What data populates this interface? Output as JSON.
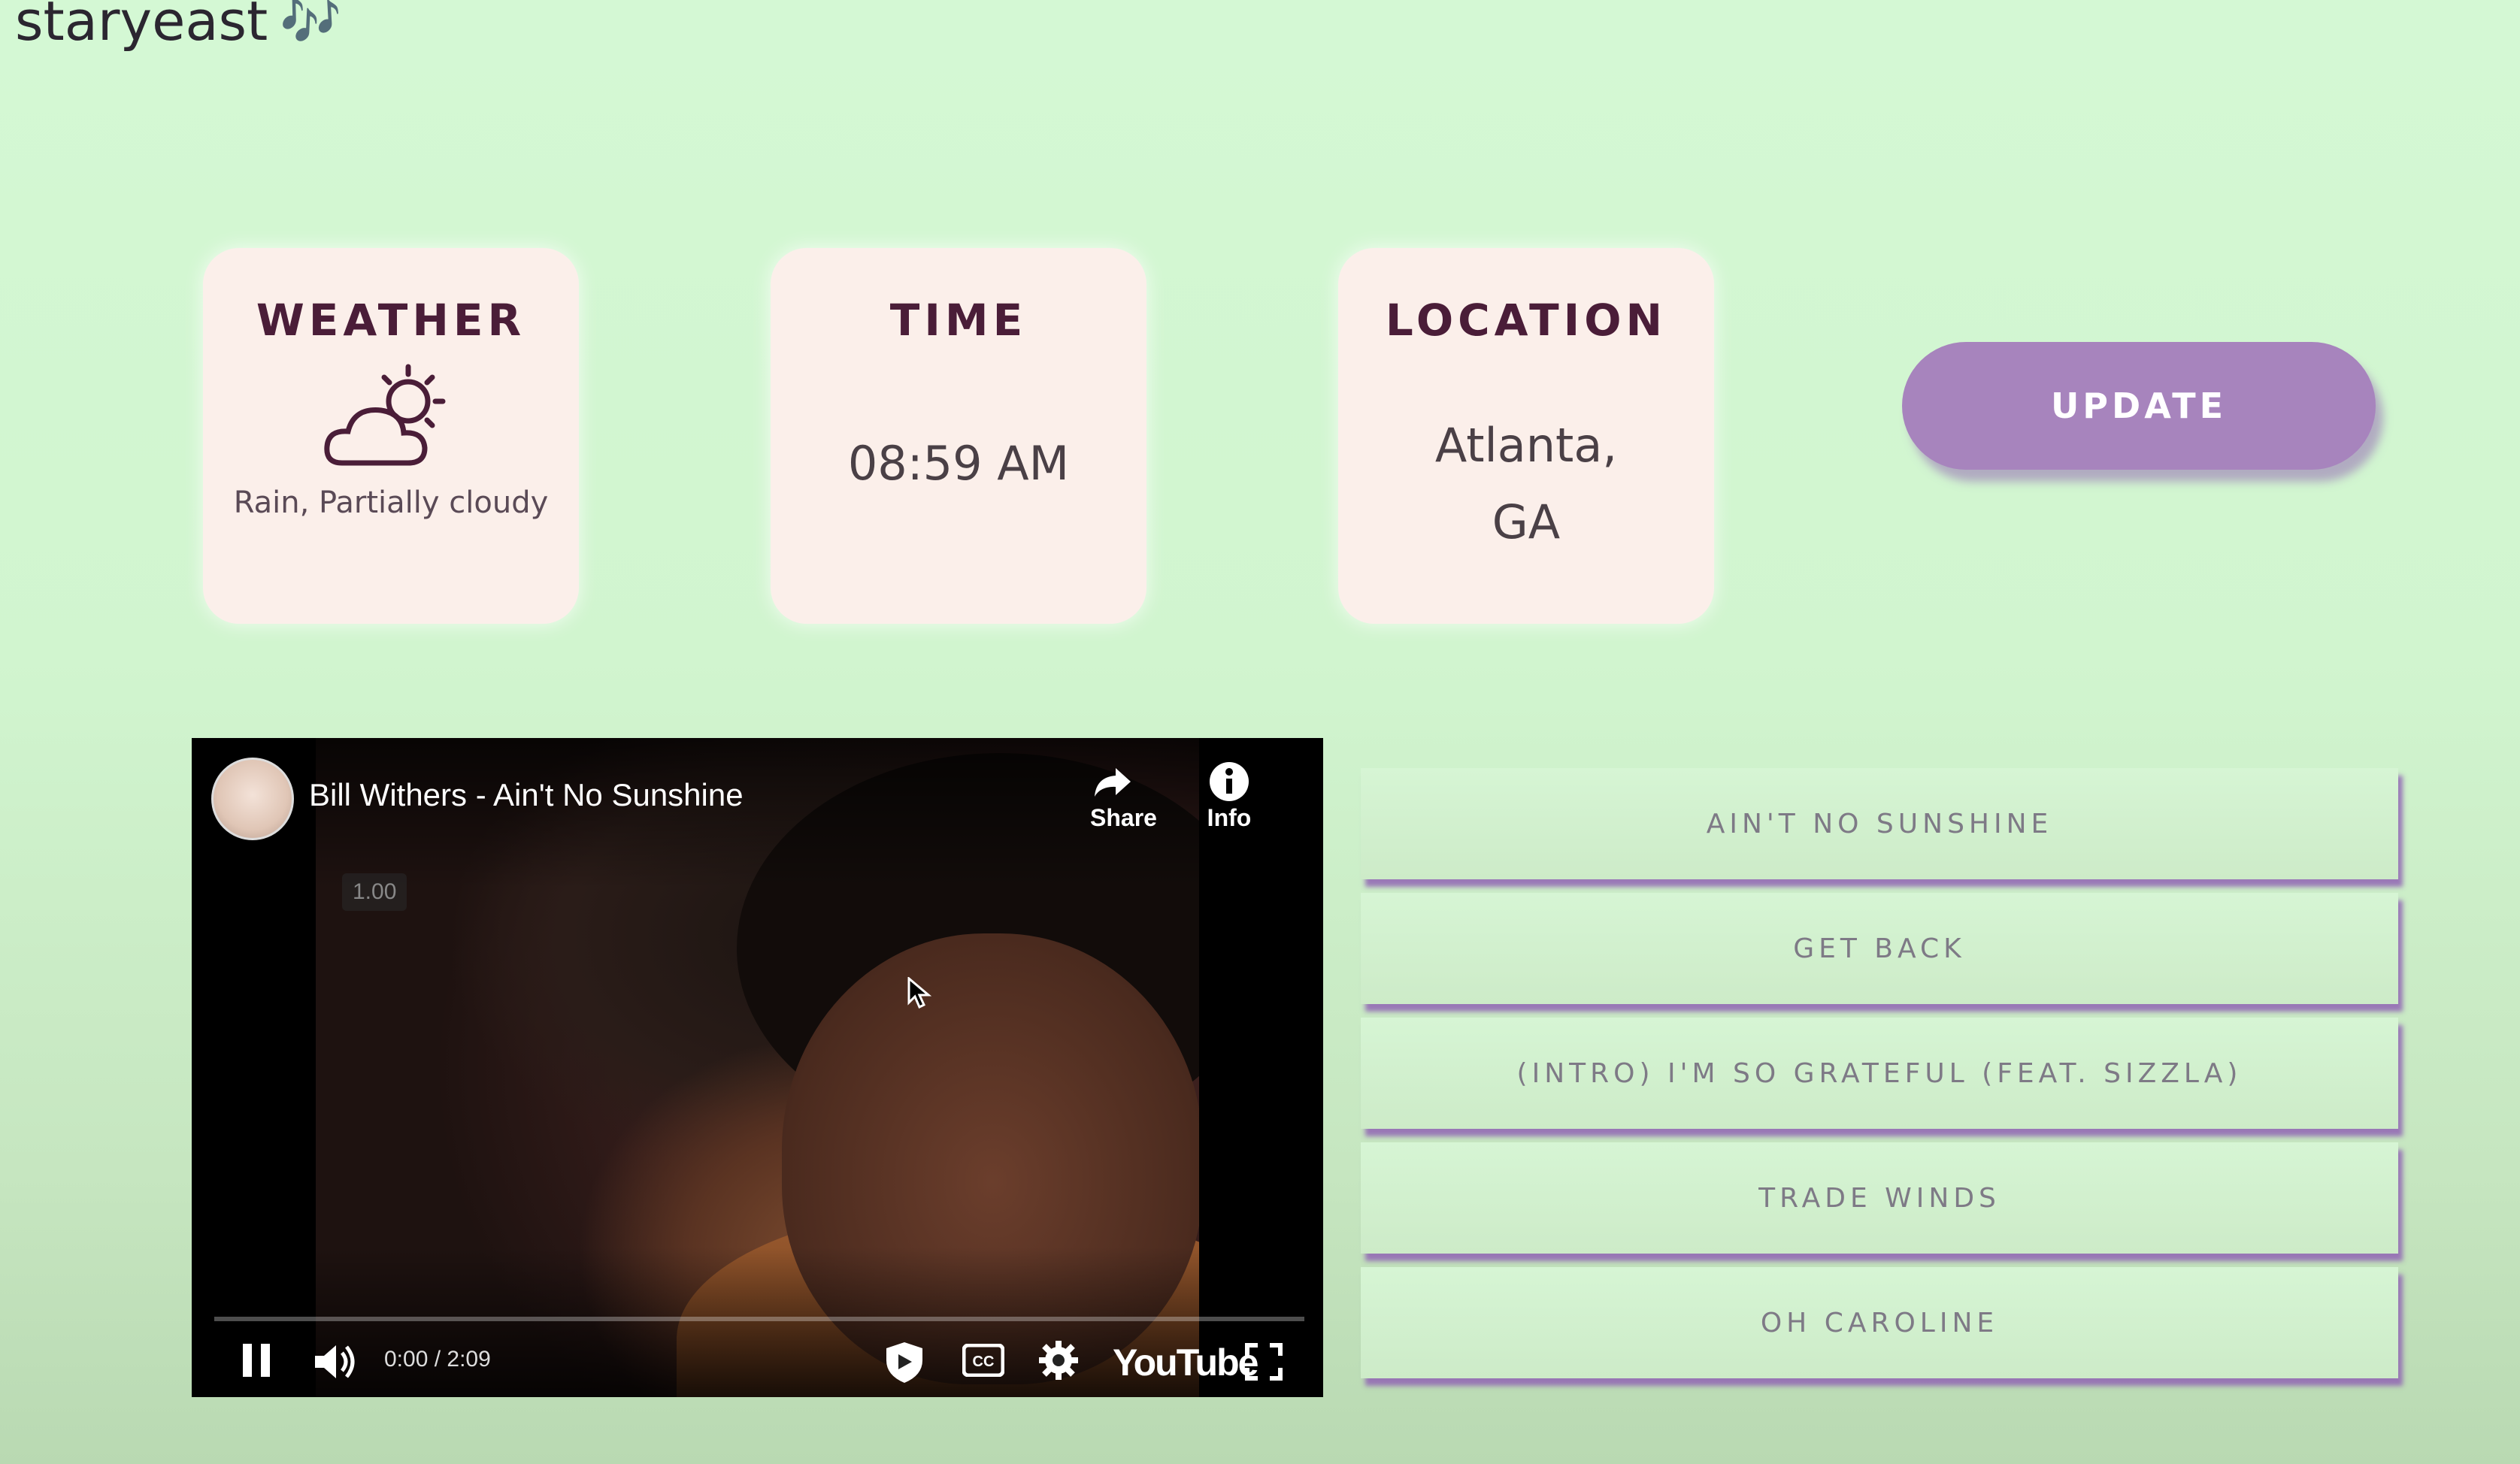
{
  "app": {
    "name": "staryeast",
    "note_glyph": "🎶"
  },
  "cards": {
    "weather": {
      "heading": "WEATHER",
      "icon": "partly-cloudy-icon",
      "description": "Rain, Partially cloudy"
    },
    "time": {
      "heading": "TIME",
      "value": "08:59 AM"
    },
    "location": {
      "heading": "LOCATION",
      "city": "Atlanta,",
      "state": "GA"
    }
  },
  "update_button": {
    "label": "UPDATE"
  },
  "video": {
    "title": "Bill Withers - Ain't No Sunshine",
    "share_label": "Share",
    "info_label": "Info",
    "speed_label": "1.00",
    "time_display": "0:00 / 2:09",
    "brand": "YouTube",
    "progress": 0.0
  },
  "playlist": {
    "tracks": [
      "AIN'T NO SUNSHINE",
      "GET BACK",
      "(INTRO) I'M SO GRATEFUL (FEAT. SIZZLA)",
      "TRADE WINDS",
      "OH CAROLINE"
    ]
  },
  "colors": {
    "background": "#d4f8d4",
    "card": "#fbefea",
    "accent_purple": "#a784bd",
    "heading": "#4a1d38"
  }
}
